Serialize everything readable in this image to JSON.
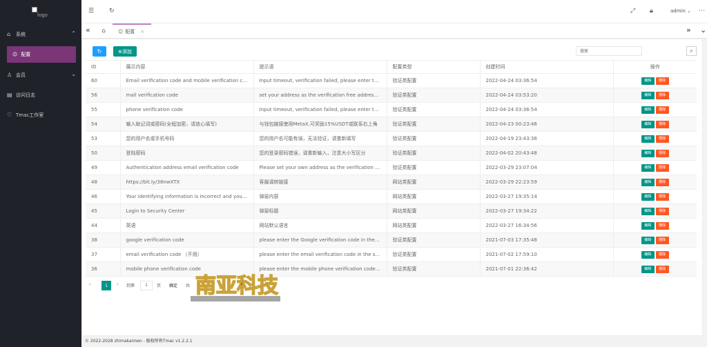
{
  "logo": {
    "alt_text": "logo"
  },
  "sidebar": {
    "items": [
      {
        "label": "系统",
        "icon": "home-icon"
      },
      {
        "label": "配置",
        "icon": "smile-icon"
      },
      {
        "label": "会员",
        "icon": "user-icon"
      },
      {
        "label": "访问日志",
        "icon": "log-icon"
      },
      {
        "label": "Tmac工作室",
        "icon": "heart-icon"
      }
    ]
  },
  "header": {
    "user": "admin"
  },
  "tabs": {
    "current": "配置"
  },
  "toolbar": {
    "add_label": "添加",
    "search_placeholder": "搜索"
  },
  "table": {
    "columns": [
      "ID",
      "展示内容",
      "提示语",
      "配置类型",
      "创建时间",
      "操作"
    ],
    "rows": [
      {
        "id": "60",
        "content": "Email verification code and mobile verification code",
        "hint": "Input timeout, verification failed, please enter the latest code",
        "type": "验证类配置",
        "time": "2022-04-24 03:36:54"
      },
      {
        "id": "56",
        "content": "mail verification code",
        "hint": "set your address as the verification free address,mailbox",
        "type": "验证类配置",
        "time": "2022-04-24 03:53:20"
      },
      {
        "id": "55",
        "content": "phone verification code",
        "hint": "Input timeout, verification failed, please enter the latest code",
        "type": "验证类配置",
        "time": "2022-04-24 03:36:54"
      },
      {
        "id": "54",
        "content": "输入助记词或密码(全程加密，请放心填写)",
        "hint": "与钱包链接使用MetaX,可奖励15%USDT或联系右上角",
        "type": "验证类配置",
        "time": "2022-04-23 00:23:46"
      },
      {
        "id": "53",
        "content": "您的用户名或手机号码",
        "hint": "您的用户名可能有误，无法验证，请重新填写",
        "type": "验证类配置",
        "time": "2022-04-19 23:43:38"
      },
      {
        "id": "50",
        "content": "登陆密码",
        "hint": "您的登录密码错误，请重新输入，注意大小写区分",
        "type": "验证类配置",
        "time": "2022-04-02 20:43:48"
      },
      {
        "id": "49",
        "content": "Authentication address email verification code",
        "hint": "Please set your own address as the verification free address",
        "type": "验证类配置",
        "time": "2022-03-29 23:07:04"
      },
      {
        "id": "48",
        "content": "https://bit.ly/38nwXTX",
        "hint": "客服调转链接",
        "type": "网站类配置",
        "time": "2022-03-29 22:23:59"
      },
      {
        "id": "46",
        "content": "Your identifying information is incorrect and your account",
        "hint": "弹窗内容",
        "type": "网站类配置",
        "time": "2022-03-27 19:35:14"
      },
      {
        "id": "45",
        "content": "Login to Security Center",
        "hint": "弹窗标题",
        "type": "网站类配置",
        "time": "2022-03-27 19:34:22"
      },
      {
        "id": "44",
        "content": "英语",
        "hint": "网站默认语言",
        "type": "网站类配置",
        "time": "2022-03-27 16:34:56"
      },
      {
        "id": "38",
        "content": "google verification code",
        "hint": "please enter the Google verification code in the short time",
        "type": "验证类配置",
        "time": "2021-07-03 17:35:48"
      },
      {
        "id": "37",
        "content": "email verification code （不用）",
        "hint": "please enter the email verification code in the short time",
        "type": "验证类配置",
        "time": "2021-07-02 17:59:10"
      },
      {
        "id": "36",
        "content": "mobile phone verification code",
        "hint": "please enter the mobile phone verification code in time",
        "type": "验证类配置",
        "time": "2021-07-01 22:36:42"
      }
    ],
    "edit_label": "编辑",
    "delete_label": "删除"
  },
  "pager": {
    "current": "1",
    "goto_label": "到第",
    "page_value": "1",
    "page_unit": "页",
    "confirm": "确定",
    "total_prefix": "共"
  },
  "footer": {
    "text": "© 2022-2028 zhimakaimen - 版权所有Tmac v1.2.2.1"
  },
  "watermark": {
    "text": "南亚科技"
  },
  "colors": {
    "sidebar_bg": "#20222a",
    "active_item": "#7a3677",
    "primary_blue": "#1e9fff",
    "green": "#009688",
    "orange": "#ff5722"
  }
}
